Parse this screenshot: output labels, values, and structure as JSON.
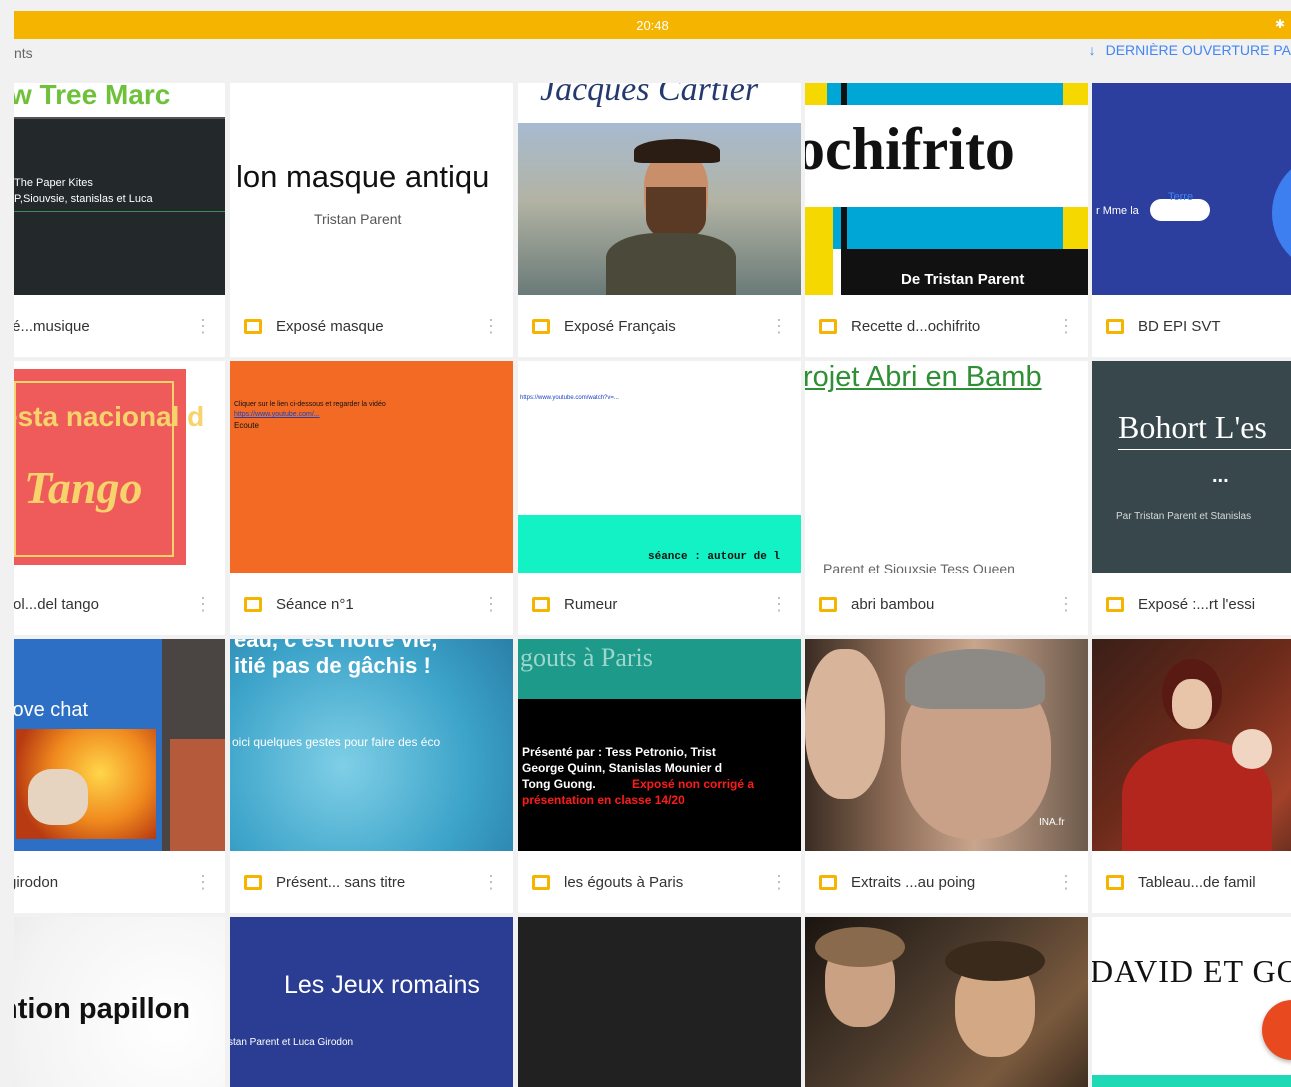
{
  "status_bar": {
    "time": "20:48",
    "bluetooth": "✱"
  },
  "toolbar": {
    "left_text": "nts",
    "sort_arrow": "↓",
    "sort_label": "DERNIÈRE OUVERTURE PA"
  },
  "files": [
    {
      "title": "posé...musique",
      "thumb": {
        "heading": "w Tree Marc",
        "line1": "The Paper Kites",
        "line2": "P,Siouvsie, stanislas et Luca"
      }
    },
    {
      "title": "Exposé masque",
      "thumb": {
        "heading": "lon masque antiqu",
        "subtitle": "Tristan Parent"
      }
    },
    {
      "title": "Exposé Français",
      "thumb": {
        "heading": "Jacques Cartier"
      }
    },
    {
      "title": "Recette d...ochifrito",
      "thumb": {
        "heading": "ochifrito",
        "footer": "De Tristan Parent"
      }
    },
    {
      "title": "BD EPI SVT",
      "thumb": {
        "text": "r Mme la",
        "cloud_text": "Terre"
      }
    },
    {
      "title": "pañol...del tango",
      "thumb": {
        "heading": "esta nacional d",
        "script": "Tango"
      }
    },
    {
      "title": "Séance n°1",
      "thumb": {
        "line1": "Cliquer sur le lien ci-dessous et regarder la vidéo",
        "line2": "https://www.youtube.com/...",
        "line3": "Ecoute"
      }
    },
    {
      "title": "Rumeur",
      "thumb": {
        "link": "https://www.youtube.com/watch?v=...",
        "band_text": "séance : autour de l"
      }
    },
    {
      "title": "abri bambou",
      "thumb": {
        "heading": "rojet Abri en Bamb",
        "footer": "Parent et Siouxsie Tess Queen"
      }
    },
    {
      "title": "Exposé :...rt l'essi",
      "thumb": {
        "heading": "Bohort L'es",
        "dots": "...",
        "subtitle": "Par Tristan Parent et Stanislas"
      }
    },
    {
      "title": "ca girodon",
      "thumb": {
        "heading": "love chat"
      }
    },
    {
      "title": "Présent... sans titre",
      "thumb": {
        "heading1": "eau, c'est notre vie,",
        "heading2": "itié pas de gâchis !",
        "text": "oici quelques gestes pour faire des éco"
      }
    },
    {
      "title": "les égouts à Paris",
      "thumb": {
        "heading": "gouts à Paris",
        "line1": "Présenté par : Tess Petronio, Trist",
        "line2": "George Quinn, Stanislas Mounier d",
        "line3": "Tong Guong.",
        "red1": "Exposé non corrigé a",
        "red2": "présentation en classe 14/20"
      }
    },
    {
      "title": "Extraits ...au poing",
      "thumb": {
        "caption": "INA.fr"
      }
    },
    {
      "title": "Tableau...de famil",
      "thumb": {}
    },
    {
      "title": "",
      "thumb": {
        "heading": "ntion papillon"
      }
    },
    {
      "title": "",
      "thumb": {
        "heading": "Les Jeux romains",
        "subtitle": "stan Parent et Luca Girodon"
      }
    },
    {
      "title": "",
      "thumb": {}
    },
    {
      "title": "",
      "thumb": {}
    },
    {
      "title": "",
      "thumb": {
        "heading": "DAVID ET GOLI"
      }
    }
  ]
}
